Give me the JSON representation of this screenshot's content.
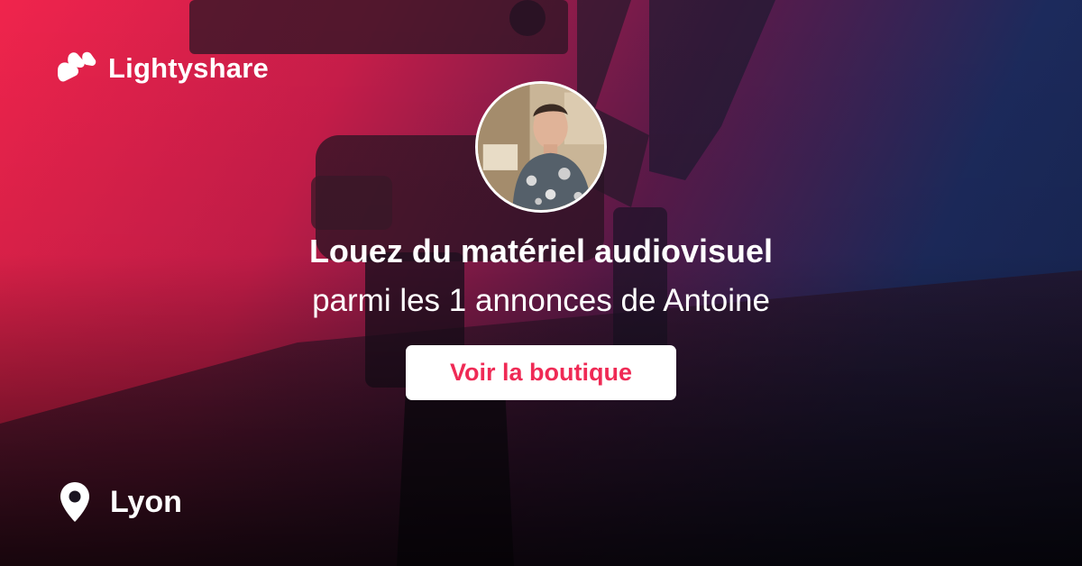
{
  "brand": {
    "name": "Lightyshare",
    "logo_icon": "lightyshare-logo-icon"
  },
  "headline": "Louez du matériel audiovisuel",
  "subline": "parmi les 1 annonces de Antoine",
  "cta": {
    "label": "Voir la boutique"
  },
  "location": {
    "icon": "map-pin-icon",
    "city": "Lyon"
  },
  "colors": {
    "accent": "#ef2a55",
    "gradient_red": "#f0244c",
    "gradient_navy": "#16244f",
    "text": "#ffffff"
  }
}
